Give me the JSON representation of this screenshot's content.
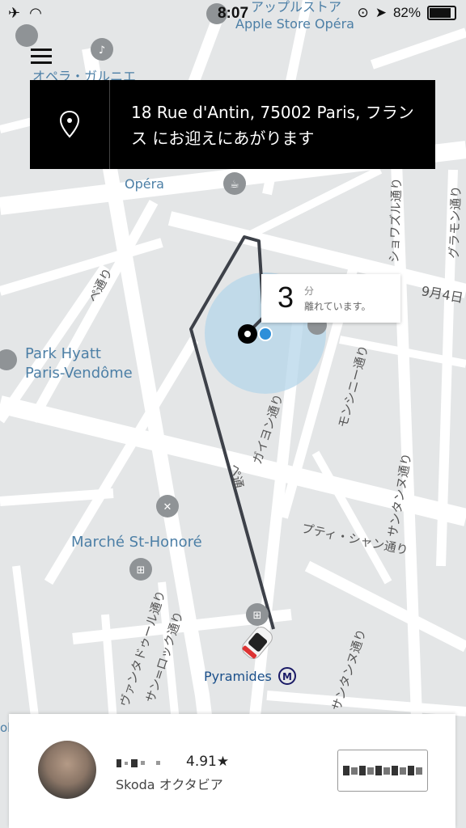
{
  "status_bar": {
    "time": "8:07",
    "battery_percent": "82%"
  },
  "pickup": {
    "address": "18 Rue d'Antin, 75002 Paris, フランス にお迎えにあがります"
  },
  "eta": {
    "minutes": "3",
    "unit": "分",
    "label": "離れています。"
  },
  "map_labels": {
    "apple_store_top": "アップルストア",
    "apple_store": "Apple Store Opéra",
    "opera_garnier": "オペラ・ガルニエ",
    "opera": "Opéra",
    "park_hyatt_1": "Park Hyatt",
    "park_hyatt_2": "Paris-Vendôme",
    "marche": "Marché St-Honoré",
    "pyramides": "Pyramides",
    "rue_paix": "ペ通り",
    "choiseul": "ショワズル通り",
    "gramont": "グラモン通り",
    "sept4": "9月4日",
    "monsigny": "モンシニー通り",
    "gaillon": "ガイヨン通り",
    "sainte_anne": "サンタンヌ通り",
    "sainte_anne_2": "サンタンヌ通り",
    "petits_champs": "プティ・シャン通り",
    "ventadour": "ヴァンタドゥール通り",
    "roch": "サン=ロック通り",
    "pyramides_rue": "ピラミッド通り",
    "rue_short": "ペ通",
    "ole": "ole"
  },
  "driver": {
    "rating": "4.91★",
    "car": "Skoda オクタビア"
  },
  "icons": {
    "airplane": "airplane-icon",
    "wifi": "wifi-icon",
    "location_arrow": "location-arrow-icon",
    "lock_rotation": "orientation-lock-icon",
    "menu": "hamburger-menu-icon",
    "pin": "map-pin-icon"
  },
  "colors": {
    "route": "#3d4149",
    "accuracy_circle": "#b5d6ea",
    "user_dot": "#2e8fd9",
    "poi": "#8f9396",
    "label": "#4c7fa6"
  }
}
